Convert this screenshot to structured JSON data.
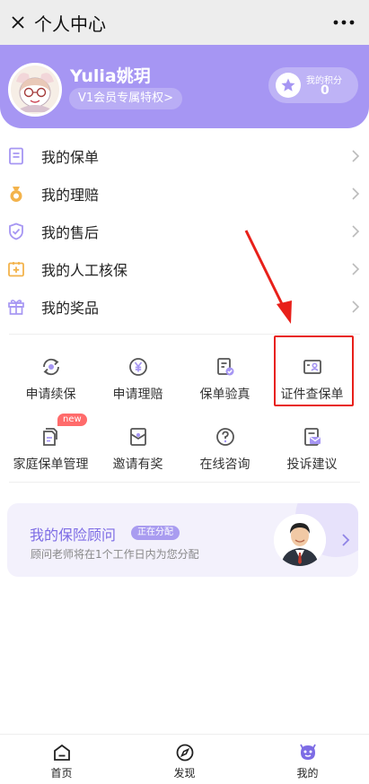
{
  "topbar": {
    "title": "个人中心"
  },
  "profile": {
    "name": "Yulia姚玥",
    "vip_text": "V1会员专属特权>",
    "points_label": "我的积分",
    "points_value": "0"
  },
  "menu": [
    {
      "label": "我的保单",
      "icon": "policy-list-icon"
    },
    {
      "label": "我的理赔",
      "icon": "claim-bag-icon"
    },
    {
      "label": "我的售后",
      "icon": "shield-check-icon"
    },
    {
      "label": "我的人工核保",
      "icon": "medical-plus-icon"
    },
    {
      "label": "我的奖品",
      "icon": "gift-icon"
    }
  ],
  "grid": [
    {
      "label": "申请续保",
      "icon": "renew-icon"
    },
    {
      "label": "申请理赔",
      "icon": "yen-coin-icon"
    },
    {
      "label": "保单验真",
      "icon": "verify-doc-icon"
    },
    {
      "label": "证件查保单",
      "icon": "id-card-icon"
    },
    {
      "label": "家庭保单管理",
      "icon": "family-doc-icon",
      "badge": "new"
    },
    {
      "label": "邀请有奖",
      "icon": "invite-envelope-icon"
    },
    {
      "label": "在线咨询",
      "icon": "question-icon"
    },
    {
      "label": "投诉建议",
      "icon": "complaint-mail-icon"
    }
  ],
  "advisor": {
    "title": "我的保险顾问",
    "badge": "正在分配",
    "desc": "顾问老师将在1个工作日内为您分配"
  },
  "nav": [
    {
      "label": "首页",
      "icon": "home-icon"
    },
    {
      "label": "发现",
      "icon": "compass-icon"
    },
    {
      "label": "我的",
      "icon": "profile-face-icon",
      "active": true
    }
  ],
  "colors": {
    "accent": "#a696f3",
    "highlight": "#e8201a",
    "icon_gray": "#555555"
  }
}
